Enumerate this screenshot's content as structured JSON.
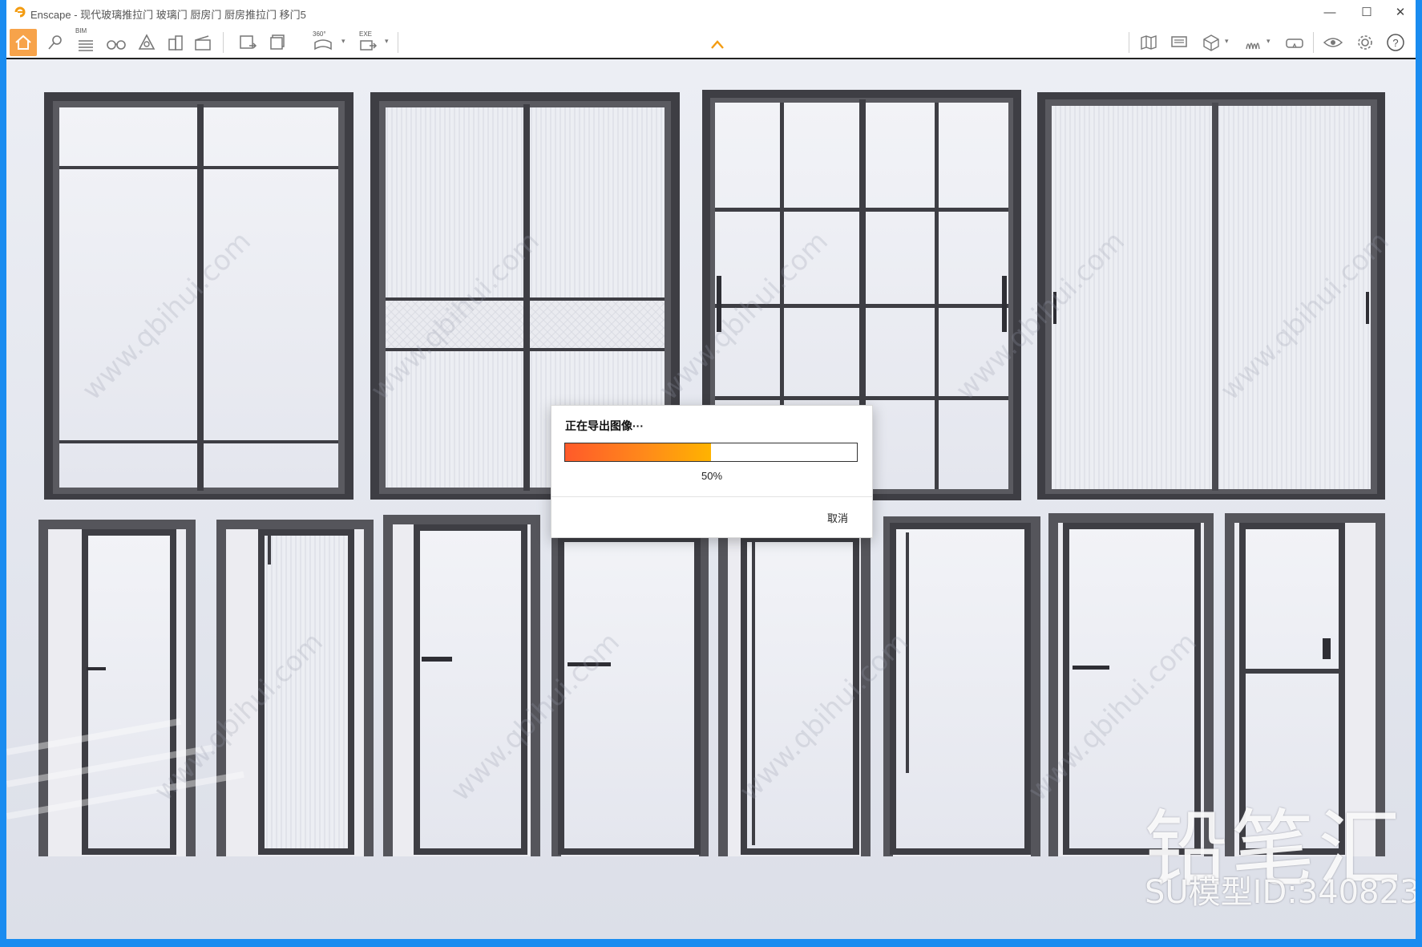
{
  "window": {
    "app_name": "Enscape",
    "title": "Enscape - 现代玻璃推拉门 玻璃门 厨房门 厨房推拉门 移门5",
    "controls": {
      "minimize": "—",
      "maximize": "☐",
      "close": "✕"
    }
  },
  "toolbar": {
    "bim_label": "BIM",
    "pano_label": "360°",
    "exe_label": "EXE",
    "help_label": "?",
    "accent_color": "#f7a34a"
  },
  "dialog": {
    "title": "正在导出图像···",
    "progress": 0.5,
    "progress_text": "50%",
    "cancel_label": "取消"
  },
  "watermark": {
    "brand": "铅笔汇",
    "id_text": "SU模型ID:340823",
    "site": "www.qbihui.com"
  }
}
